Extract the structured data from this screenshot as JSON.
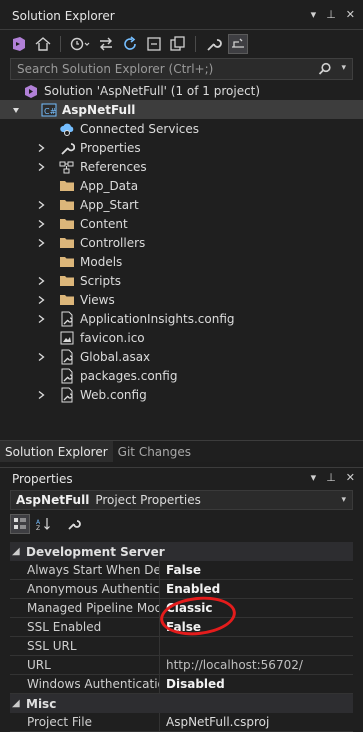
{
  "solution_explorer": {
    "title": "Solution Explorer",
    "title_icons": [
      "dropdown-icon",
      "pin-icon",
      "close-icon"
    ],
    "search_placeholder": "Search Solution Explorer (Ctrl+;)",
    "tree": [
      {
        "label": "Solution 'AspNetFull' (1 of 1 project)",
        "icon": "solution-icon",
        "level": 0,
        "expander": "none"
      },
      {
        "label": "AspNetFull",
        "icon": "csharp-project-icon",
        "level": 0,
        "expander": "expanded",
        "selected": true,
        "bold": true
      },
      {
        "label": "Connected Services",
        "icon": "connected-services-icon",
        "level": 1,
        "expander": "none"
      },
      {
        "label": "Properties",
        "icon": "wrench-icon",
        "level": 1,
        "expander": "collapsed"
      },
      {
        "label": "References",
        "icon": "references-icon",
        "level": 1,
        "expander": "collapsed"
      },
      {
        "label": "App_Data",
        "icon": "folder-icon",
        "level": 1,
        "expander": "none"
      },
      {
        "label": "App_Start",
        "icon": "folder-icon",
        "level": 1,
        "expander": "collapsed"
      },
      {
        "label": "Content",
        "icon": "folder-icon",
        "level": 1,
        "expander": "collapsed"
      },
      {
        "label": "Controllers",
        "icon": "folder-icon",
        "level": 1,
        "expander": "collapsed"
      },
      {
        "label": "Models",
        "icon": "folder-icon",
        "level": 1,
        "expander": "none"
      },
      {
        "label": "Scripts",
        "icon": "folder-icon",
        "level": 1,
        "expander": "collapsed"
      },
      {
        "label": "Views",
        "icon": "folder-icon",
        "level": 1,
        "expander": "collapsed"
      },
      {
        "label": "ApplicationInsights.config",
        "icon": "config-file-icon",
        "level": 1,
        "expander": "collapsed"
      },
      {
        "label": "favicon.ico",
        "icon": "image-file-icon",
        "level": 1,
        "expander": "none"
      },
      {
        "label": "Global.asax",
        "icon": "config-file-icon",
        "level": 1,
        "expander": "collapsed"
      },
      {
        "label": "packages.config",
        "icon": "config-file-icon",
        "level": 1,
        "expander": "none"
      },
      {
        "label": "Web.config",
        "icon": "config-file-icon",
        "level": 1,
        "expander": "collapsed"
      }
    ],
    "tabs": [
      {
        "label": "Solution Explorer",
        "active": true
      },
      {
        "label": "Git Changes",
        "active": false
      }
    ]
  },
  "properties": {
    "title": "Properties",
    "object_name": "AspNetFull",
    "object_type": "Project Properties",
    "categories": [
      {
        "name": "Development Server",
        "rows": [
          {
            "name": "Always Start When Debuggi",
            "value": "False",
            "style": "bold"
          },
          {
            "name": "Anonymous Authentication",
            "value": "Enabled",
            "style": "bold"
          },
          {
            "name": "Managed Pipeline Mode",
            "value": "Classic",
            "style": "bold"
          },
          {
            "name": "SSL Enabled",
            "value": "False",
            "style": "bold"
          },
          {
            "name": "SSL URL",
            "value": "",
            "style": "normal"
          },
          {
            "name": "URL",
            "value": "http://localhost:56702/",
            "style": "dim"
          },
          {
            "name": "Windows Authentication",
            "value": "Disabled",
            "style": "bold"
          }
        ]
      },
      {
        "name": "Misc",
        "rows": [
          {
            "name": "Project File",
            "value": "AspNetFull.csproj",
            "style": "normal"
          }
        ]
      }
    ]
  },
  "colors": {
    "background": "#1e1e1e",
    "selection": "#3d3d3d",
    "folder": "#dcb67a",
    "accent_purple": "#b180d7",
    "accent_blue": "#75beff",
    "annotation": "#e41c1c"
  }
}
